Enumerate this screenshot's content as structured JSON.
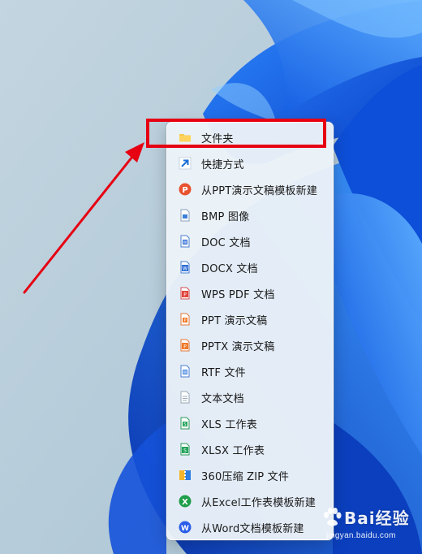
{
  "menu": {
    "items": [
      {
        "label": "文件夹",
        "icon": "folder-icon"
      },
      {
        "label": "快捷方式",
        "icon": "shortcut-icon"
      },
      {
        "label": "从PPT演示文稿模板新建",
        "icon": "wps-presentation-template-icon"
      },
      {
        "label": "BMP 图像",
        "icon": "bmp-image-icon"
      },
      {
        "label": "DOC 文档",
        "icon": "doc-document-icon"
      },
      {
        "label": "DOCX 文档",
        "icon": "docx-document-icon"
      },
      {
        "label": "WPS PDF 文档",
        "icon": "pdf-document-icon"
      },
      {
        "label": "PPT 演示文稿",
        "icon": "ppt-presentation-icon"
      },
      {
        "label": "PPTX 演示文稿",
        "icon": "pptx-presentation-icon"
      },
      {
        "label": "RTF 文件",
        "icon": "rtf-document-icon"
      },
      {
        "label": "文本文档",
        "icon": "text-document-icon"
      },
      {
        "label": "XLS 工作表",
        "icon": "xls-spreadsheet-icon"
      },
      {
        "label": "XLSX 工作表",
        "icon": "xlsx-spreadsheet-icon"
      },
      {
        "label": "360压缩 ZIP 文件",
        "icon": "zip-archive-icon"
      },
      {
        "label": "从Excel工作表模板新建",
        "icon": "wps-spreadsheet-template-icon"
      },
      {
        "label": "从Word文档模板新建",
        "icon": "wps-writer-template-icon"
      }
    ]
  },
  "annotation": {
    "highlight_color": "#e60012",
    "highlighted_item": "文件夹"
  },
  "watermark": {
    "brand": "Bai经验",
    "url": "jingyan.baidu.com"
  },
  "colors": {
    "wallpaper_base": "#b9cfdc",
    "wallpaper_accent": "#0a5ee6",
    "menu_background": "#ecf2f8"
  }
}
